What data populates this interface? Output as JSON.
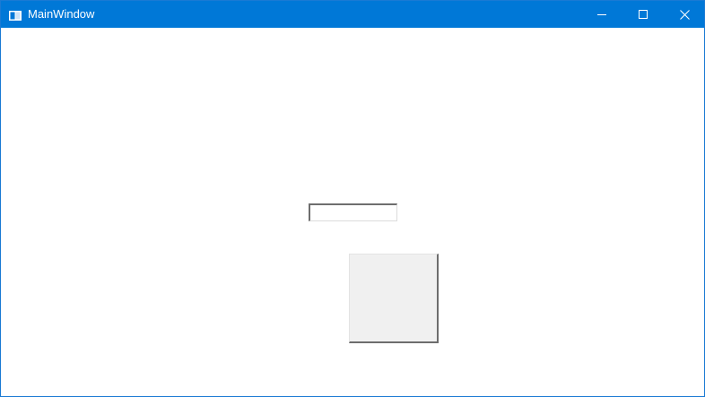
{
  "window": {
    "title": "MainWindow",
    "app_icon": "window-app-icon",
    "accent_color": "#0078d7",
    "controls": {
      "minimize_icon": "minimize-icon",
      "maximize_icon": "maximize-icon",
      "close_icon": "close-icon"
    }
  },
  "form": {
    "text_input": {
      "value": "",
      "placeholder": ""
    },
    "button": {
      "label": ""
    }
  }
}
